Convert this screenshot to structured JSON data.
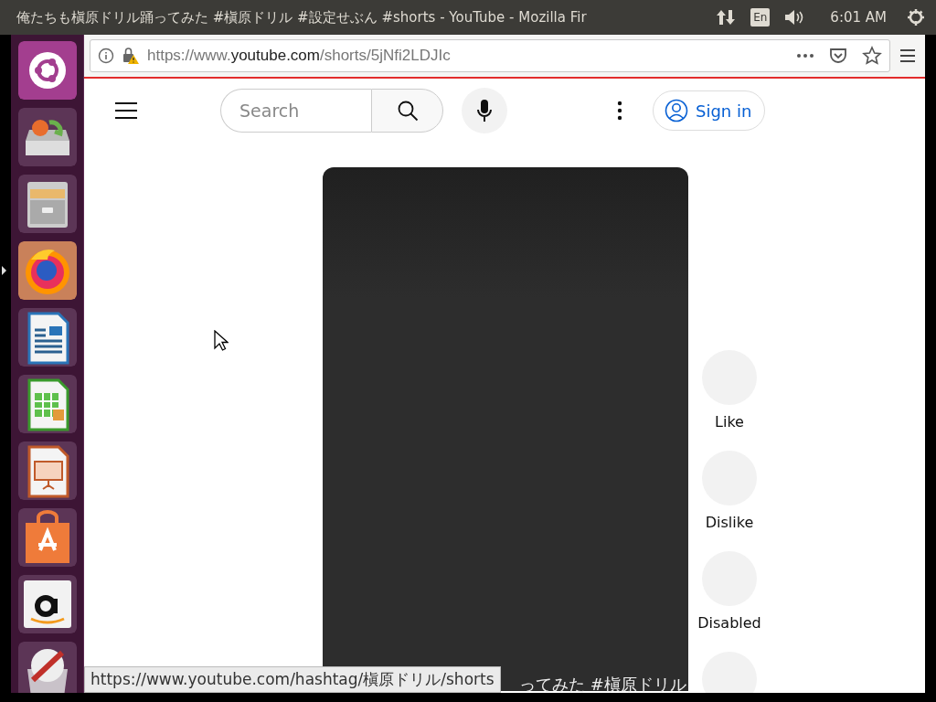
{
  "top_bar": {
    "window_title": "俺たちも槇原ドリル踊ってみた #槇原ドリル #設定せぶん #shorts - YouTube - Mozilla Fir",
    "keyboard_layout": "En",
    "clock": "6:01 AM"
  },
  "launcher": {
    "items": [
      {
        "kind": "ubuntu",
        "running": false
      },
      {
        "kind": "backup",
        "running": false
      },
      {
        "kind": "files",
        "running": false
      },
      {
        "kind": "firefox",
        "running": true
      },
      {
        "kind": "writer",
        "running": false
      },
      {
        "kind": "calc",
        "running": false
      },
      {
        "kind": "impress",
        "running": false
      },
      {
        "kind": "store",
        "running": false
      },
      {
        "kind": "amazon",
        "running": false
      },
      {
        "kind": "updater",
        "running": false
      }
    ]
  },
  "browser": {
    "url_prefix": "https://www.",
    "url_domain": "youtube.com",
    "url_path": "/shorts/5jNfi2LDJIc",
    "status_url": "https://www.youtube.com/hashtag/槇原ドリル/shorts"
  },
  "youtube": {
    "search": {
      "placeholder": "Search"
    },
    "sign_in": "Sign in",
    "short_caption": "ってみた #槇原ドリル",
    "actions": [
      {
        "kind": "labeled",
        "label": "Like"
      },
      {
        "kind": "labeled",
        "label": "Dislike"
      },
      {
        "kind": "labeled",
        "label": "Disabled"
      },
      {
        "kind": "plain"
      }
    ]
  }
}
